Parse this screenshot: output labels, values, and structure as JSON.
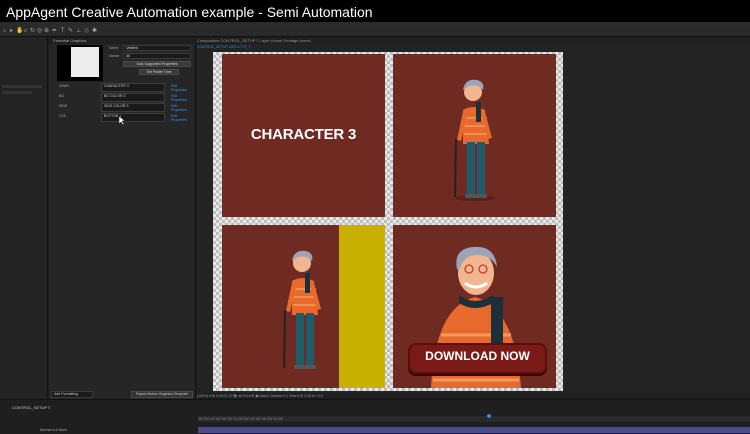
{
  "video_title": "AppAgent Creative Automation example - Semi Automation",
  "essential_graphics": {
    "tab_label": "Essential Graphics",
    "name_label": "Name",
    "name_value": "Untitled",
    "master_label": "Master",
    "master_value": "All",
    "solo_button": "Solo Supported Properties",
    "set_poster_button": "Set Poster Time",
    "rows": [
      {
        "name": "CHAR",
        "value": "CHARACTER 3",
        "link": "Edit Properties"
      },
      {
        "name": "BG",
        "value": "BG COLOR 3",
        "link": "Edit Properties"
      },
      {
        "name": "SIDE",
        "value": "SIDE COLOR 3",
        "link": "Edit Properties"
      },
      {
        "name": "CTA",
        "value": "BUTTON 1",
        "link": "Edit Properties"
      }
    ],
    "bottom_select": "Add Formatting",
    "export_button": "Export Motion Graphics Template"
  },
  "composition": {
    "tabs": "Composition  CONTROL_SETUP   ≡     Layer (none)        Footage (none)",
    "breadcrumb": "CONTROL_SETUP  ◂  BG  ◂  TXT_1",
    "character_text": "CHARACTER 3",
    "download_button": "DOWNLOAD NOW",
    "footer": "(100%)   ▾    ⊞   0;00;01;12   📷  ♣  Full   ▾   ⊞  ▣   Active Camera   ▾   1 View   ▾   ⊟  ⊡  ⊞  ⊕  +0.0"
  },
  "timeline": {
    "tab": "CONTROL_SETUP  ≡",
    "layer": "Normal   ▾      ⊘   None",
    "ruler": "00f       05f       10f       15f       20f       25f       01:00f       05f       10f       15f       20f       25f       02:00f"
  },
  "colors": {
    "panel_red": "#6f2a21",
    "side_yellow": "#c7b000",
    "cta_red": "#7a1b17",
    "accent_blue": "#2d8ceb"
  }
}
